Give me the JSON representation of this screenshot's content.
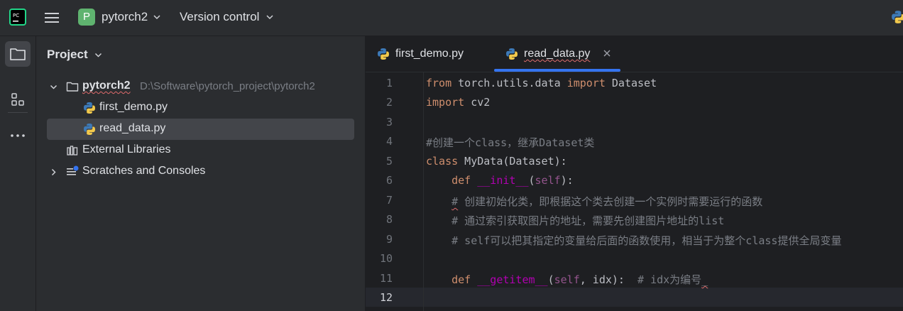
{
  "titlebar": {
    "project_initial": "P",
    "project_name": "pytorch2",
    "vcs_label": "Version control"
  },
  "panel": {
    "title": "Project"
  },
  "tree": {
    "root_name": "pytorch2",
    "root_path": "D:\\Software\\pytorch_project\\pytorch2",
    "files": [
      "first_demo.py",
      "read_data.py"
    ],
    "external_libraries": "External Libraries",
    "scratches": "Scratches and Consoles"
  },
  "tabs": [
    {
      "label": "first_demo.py"
    },
    {
      "label": "read_data.py"
    }
  ],
  "editor": {
    "line_numbers": [
      "1",
      "2",
      "3",
      "4",
      "5",
      "6",
      "7",
      "8",
      "9",
      "10",
      "11",
      "12"
    ],
    "current_line": "12",
    "lines": {
      "l1": {
        "a": "from",
        "b": " torch.utils.data ",
        "c": "import",
        "d": " Dataset"
      },
      "l2": {
        "a": "import",
        "b": " cv2"
      },
      "l4": {
        "a": "#创建一个class，继承Dataset类"
      },
      "l5": {
        "a": "class",
        "b": " MyData(Dataset):"
      },
      "l6": {
        "a": "    ",
        "b": "def",
        "c": " ",
        "d": "__init__",
        "e": "(",
        "f": "self",
        "g": "):"
      },
      "l7": {
        "a": "    ",
        "b": "#",
        "c": " 创建初始化类，即根据这个类去创建一个实例时需要运行的函数"
      },
      "l8": {
        "a": "    # 通过索引获取图片的地址，需要先创建图片地址的list"
      },
      "l9": {
        "a": "    # self可以把其指定的变量给后面的函数使用，相当于为整个class提供全局变量"
      },
      "l11": {
        "a": "    ",
        "b": "def",
        "c": " ",
        "d": "__getitem__",
        "e": "(",
        "f": "self",
        "g": ", idx):  ",
        "h": "# idx为编号",
        "i": "_"
      }
    }
  },
  "colors": {
    "background": "#1e1f22",
    "panel": "#2b2d30",
    "accent": "#3574f0",
    "keyword": "#cf8e6d",
    "dunder": "#b200b2",
    "self": "#94558d",
    "comment": "#7a7e85"
  },
  "icons": {
    "logo": "pycharm-logo-icon",
    "menu": "hamburger-menu-icon",
    "folder": "folder-icon",
    "python": "python-file-icon",
    "library": "library-icon",
    "scratch": "scratches-icon",
    "structure": "structure-icon",
    "more": "more-icon",
    "close": "close-icon"
  }
}
